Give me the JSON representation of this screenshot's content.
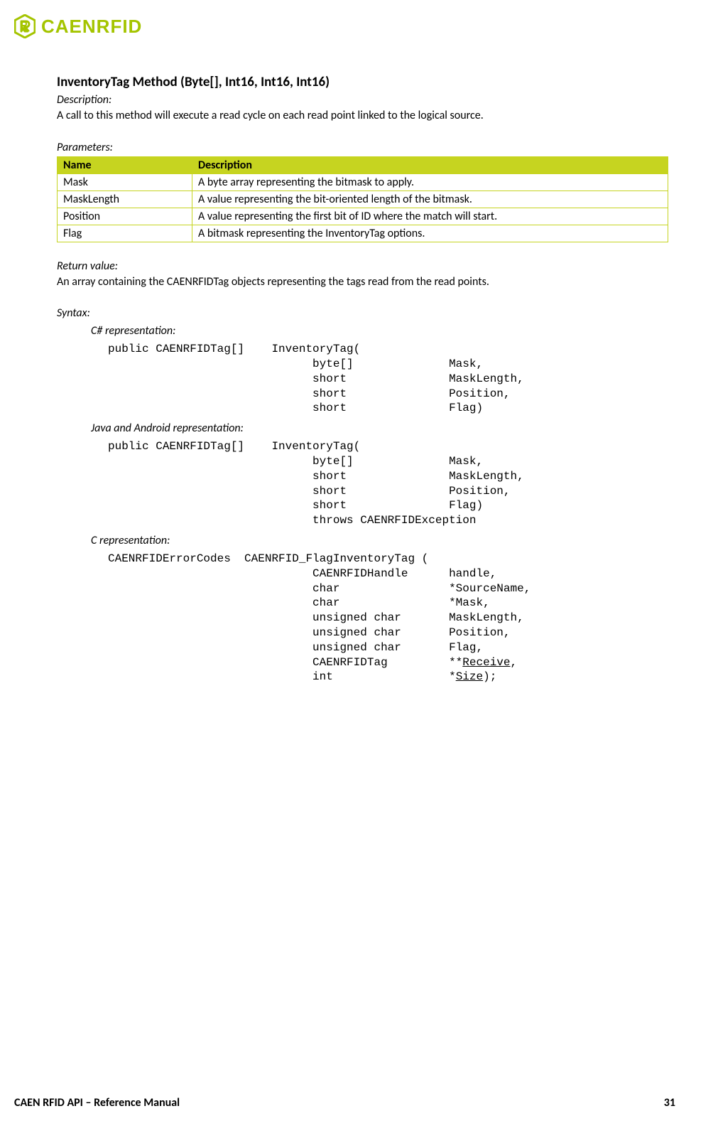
{
  "logo": {
    "text": "CAENRFID"
  },
  "method": {
    "title": "InventoryTag Method (Byte[], Int16, Int16, Int16)",
    "description_label": "Description:",
    "description_text": "A call to this method will execute a read cycle on each read point linked to the logical source.",
    "parameters_label": "Parameters:",
    "table": {
      "header_name": "Name",
      "header_desc": "Description",
      "rows": [
        {
          "name": "Mask",
          "desc": "A byte array representing the bitmask to apply."
        },
        {
          "name": "MaskLength",
          "desc": "A value representing the bit-oriented length of the bitmask."
        },
        {
          "name": "Position",
          "desc": "A value representing the first bit of ID where the match will start."
        },
        {
          "name": "Flag",
          "desc": "A bitmask representing the InventoryTag options."
        }
      ]
    },
    "return_label": "Return value:",
    "return_text": "An array containing the CAENRFIDTag objects representing the tags read from the read points.",
    "syntax_label": "Syntax:",
    "csharp_label": "C# representation:",
    "csharp_code": "public CAENRFIDTag[]    InventoryTag(\n                              byte[]              Mask,\n                              short               MaskLength,\n                              short               Position,\n                              short               Flag)",
    "java_label": "Java and Android representation:",
    "java_code": "public CAENRFIDTag[]    InventoryTag(\n                              byte[]              Mask,\n                              short               MaskLength,\n                              short               Position,\n                              short               Flag)\n                              throws CAENRFIDException",
    "c_label": "C representation:",
    "c_code_pre": "CAENRFIDErrorCodes  CAENRFID_FlagInventoryTag (\n                              CAENRFIDHandle      handle,\n                              char                *SourceName,\n                              char                *Mask,\n                              unsigned char       MaskLength,\n                              unsigned char       Position,\n                              unsigned char       Flag,\n                              CAENRFIDTag         **",
    "c_code_receive": "Receive",
    "c_code_mid": ",\n                              int                 *",
    "c_code_size": "Size",
    "c_code_post": ");"
  },
  "footer": {
    "left": "CAEN RFID API – Reference Manual",
    "right": "31"
  }
}
